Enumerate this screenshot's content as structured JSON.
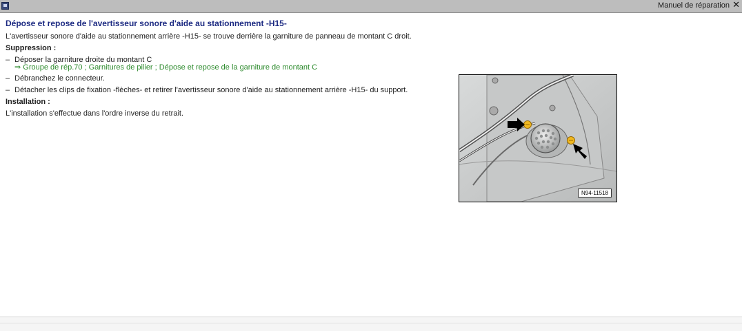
{
  "window": {
    "title": "Manuel de réparation",
    "close_icon": "close-icon",
    "app_icon": "document-icon"
  },
  "doc": {
    "heading": "Dépose et repose de l'avertisseur sonore d'aide au stationnement -H15-",
    "intro": "L'avertisseur sonore d'aide au stationnement arrière -H15- se trouve derrière la garniture de panneau de montant C droit.",
    "suppression_label": "Suppression :",
    "bullet": "–",
    "steps": [
      {
        "text": "Déposer la garniture droite du montant C",
        "link": "⇒ Groupe de rép.70 ; Garnitures de pilier ; Dépose et repose de la garniture de montant C"
      },
      {
        "text": "Débranchez le connecteur."
      },
      {
        "text": "Détacher les clips de fixation -flèches- et retirer l'avertisseur sonore d'aide au stationnement arrière -H15- du support."
      }
    ],
    "installation_label": "Installation :",
    "installation_text": "L'installation s'effectue dans l'ordre inverse du retrait.",
    "figure_label": "N94-11518"
  },
  "colors": {
    "heading": "#1c2a82",
    "link": "#2c8a2c",
    "clip": "#f0b820",
    "arrow": "#000000"
  }
}
